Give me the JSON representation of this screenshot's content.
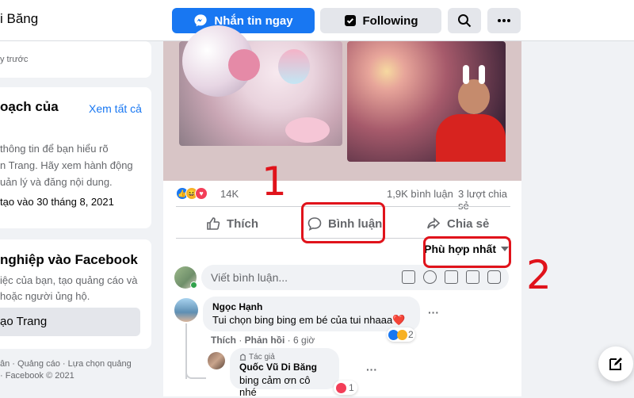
{
  "header": {
    "page_name": "i Băng",
    "message_label": "Nhắn tin ngay",
    "following_label": "Following"
  },
  "left": {
    "card1_text": "y trước",
    "card2": {
      "title": "oạch của",
      "see_all": "Xem tất cả",
      "body": [
        "thông tin để bạn hiểu rõ",
        "n Trang. Hãy xem hành động",
        "uản lý và đăng nội dung."
      ],
      "created": "tạo vào 30 tháng 8, 2021"
    },
    "card3": {
      "title": "nghiệp vào Facebook",
      "body": [
        "iệc của bạn, tạo quảng cáo và",
        "hoặc người ủng hộ."
      ],
      "button": "ạo Trang"
    },
    "footer": [
      "ân · Quảng cáo · Lựa chọn quảng",
      "· Facebook © 2021"
    ]
  },
  "post": {
    "reaction_count": "14K",
    "comments_count": "1,9K bình luận",
    "shares_count": "3 lượt chia sẻ",
    "like_label": "Thích",
    "comment_label": "Bình luận",
    "share_label": "Chia sẻ",
    "sort_label": "Phù hợp nhất",
    "comment_placeholder": "Viết bình luận...",
    "comments": [
      {
        "name": "Ngọc Hạnh",
        "text": "Tui chọn bing bing em bé của tui nhaaa❤️",
        "like": "Thích",
        "reply": "Phản hồi",
        "time": "6 giờ",
        "reactions": "2"
      }
    ],
    "reply": {
      "badge": "Tác giả",
      "name": "Quốc Vũ Di Băng",
      "text": "bing cảm ơn cô nhé",
      "reactions": "1"
    }
  },
  "annotations": {
    "one": "1",
    "two": "2"
  },
  "colors": {
    "accent": "#1877f2",
    "annotation": "#e0131b"
  }
}
